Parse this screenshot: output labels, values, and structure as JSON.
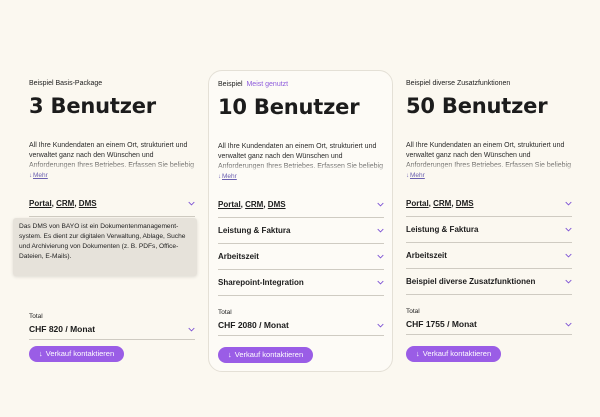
{
  "colors": {
    "accent": "#9a5de6",
    "background": "#fbf8f0",
    "badge": "#8d5bdc"
  },
  "cards": [
    {
      "eyebrow": "Beispiel Basis-Package",
      "badge": "",
      "title": "3 Benutzer",
      "description": "All Ihre Kundendaten an einem Ort, strukturiert und verwaltet ganz nach den Wünschen und Anforderungen Ihres Betriebes. Erfassen Sie beliebig",
      "more_label": "Mehr",
      "features": [
        {
          "parts": [
            "Portal",
            "CRM",
            "DMS"
          ]
        }
      ],
      "total_label": "Total",
      "price": "CHF 820 / Monat",
      "cta": "Verkauf kontaktieren"
    },
    {
      "eyebrow": "Beispiel",
      "badge": "Meist genutzt",
      "title": "10 Benutzer",
      "description": "All Ihre Kundendaten an einem Ort, strukturiert und verwaltet ganz nach den Wünschen und Anforderungen Ihres Betriebes. Erfassen Sie beliebig",
      "more_label": "Mehr",
      "features": [
        {
          "parts": [
            "Portal",
            "CRM",
            "DMS"
          ]
        },
        {
          "label": "Leistung & Faktura"
        },
        {
          "label": "Arbeitszeit"
        },
        {
          "label": "Sharepoint-Integration"
        }
      ],
      "total_label": "Total",
      "price": "CHF 2080 / Monat",
      "cta": "Verkauf kontaktieren"
    },
    {
      "eyebrow": "Beispiel diverse Zusatzfunktionen",
      "badge": "",
      "title": "50 Benutzer",
      "description": "All Ihre Kundendaten an einem Ort, strukturiert und verwaltet ganz nach den Wünschen und Anforderungen Ihres Betriebes. Erfassen Sie beliebig",
      "more_label": "Mehr",
      "features": [
        {
          "parts": [
            "Portal",
            "CRM",
            "DMS"
          ]
        },
        {
          "label": "Leistung & Faktura"
        },
        {
          "label": "Arbeitszeit"
        },
        {
          "label": "Beispiel diverse Zusatzfunktionen"
        }
      ],
      "total_label": "Total",
      "price": "CHF 1755 / Monat",
      "cta": "Verkauf kontaktieren"
    }
  ],
  "tooltip": {
    "text": "Das DMS von BAYO ist ein Dokumentenmanagement-system. Es dient zur digitalen Verwaltung, Ablage, Suche und Archivierung von Dokumenten (z. B. PDFs, Office-Dateien, E-Mails)."
  }
}
